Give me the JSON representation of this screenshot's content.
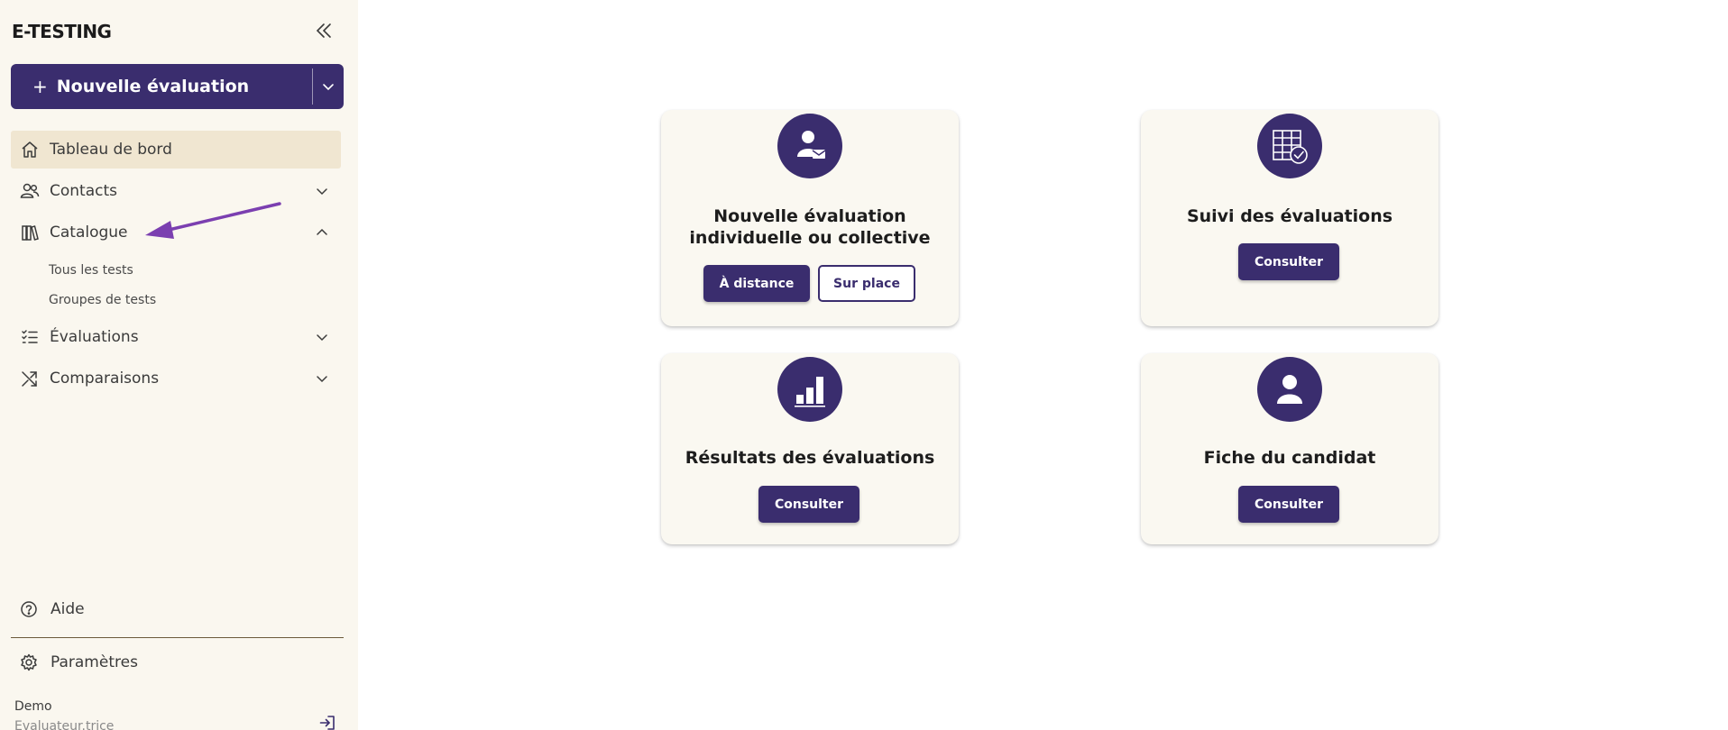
{
  "sidebar": {
    "logo": "E-TESTING",
    "new_eval_label": "Nouvelle évaluation",
    "new_eval_plus": "+",
    "nav": {
      "dashboard": "Tableau de bord",
      "contacts": "Contacts",
      "catalogue": "Catalogue",
      "catalogue_sub": [
        "Tous les tests",
        "Groupes de tests"
      ],
      "evaluations": "Évaluations",
      "comparaisons": "Comparaisons"
    },
    "help": "Aide",
    "settings": "Paramètres",
    "user_name": "Demo",
    "user_role": "Evaluateur.trice"
  },
  "cards": {
    "new_eval": {
      "title_line1": "Nouvelle évaluation",
      "title_line2": "individuelle ou collective",
      "btn_remote": "À distance",
      "btn_onsite": "Sur place"
    },
    "tracking": {
      "title": "Suivi des évaluations",
      "btn": "Consulter"
    },
    "results": {
      "title": "Résultats des évaluations",
      "btn": "Consulter"
    },
    "candidate": {
      "title": "Fiche du candidat",
      "btn": "Consulter"
    }
  },
  "colors": {
    "brand": "#3a2d6e",
    "sidebar_bg": "#faf7ef",
    "active_bg": "#f0e6d1",
    "card_bg": "#faf8f1",
    "annotation_arrow": "#7b3fb0"
  },
  "icons": {
    "logo": "wordmark",
    "collapse": "double-chevron-left-icon",
    "dashboard": "home-icon",
    "contacts": "users-icon",
    "catalogue": "books-icon",
    "evaluations": "list-check-icon",
    "comparaisons": "shuffle-icon",
    "help": "question-circle-icon",
    "settings": "gear-icon",
    "logout": "logout-icon"
  }
}
